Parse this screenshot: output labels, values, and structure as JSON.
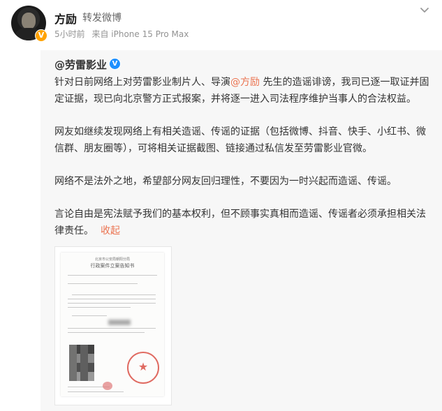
{
  "post": {
    "author": "方励",
    "action": "转发微博",
    "time": "5小时前",
    "source": "来自 iPhone 15 Pro Max"
  },
  "repost": {
    "author": "@劳雷影业",
    "p1_a": "针对日前网络上对劳雷影业制片人、导演",
    "p1_mention": "@方励",
    "p1_b": " 先生的造谣诽谤，我司已逐一取证并固定证据，现已向北京警方正式报案，并将逐一进入司法程序维护当事人的合法权益。",
    "p2": "网友如继续发现网络上有相关造谣、传谣的证据（包括微博、抖音、快手、小红书、微信群、朋友圈等），可将相关证据截图、链接通过私信发至劳雷影业官微。",
    "p3": "网络不是法外之地，希望部分网友回归理性，不要因为一时兴起而造谣、传谣。",
    "p4": "言论自由是宪法赋予我们的基本权利，但不顾事实真相而造谣、传谣者必须承担相关法律责任。",
    "collapse": "收起"
  },
  "document": {
    "header": "北京市公安局朝阳分局",
    "title": "行政案件立案告知书"
  },
  "colors": {
    "accent": "#eb7350",
    "verified_orange": "#ffa200",
    "verified_blue": "#1e90ff"
  },
  "icons": [
    "verified-badge-icon",
    "chevron-down-icon"
  ]
}
